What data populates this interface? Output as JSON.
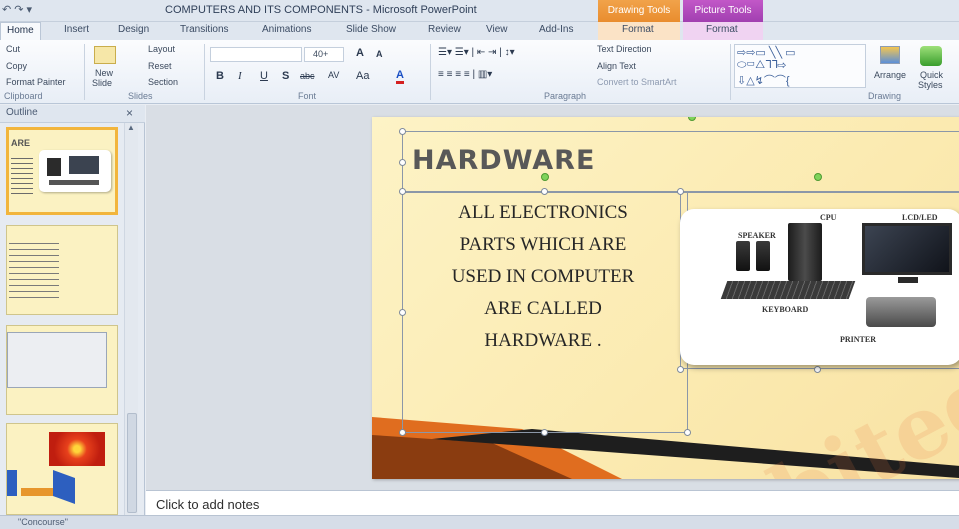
{
  "window": {
    "title": "COMPUTERS AND ITS COMPONENTS  -  Microsoft PowerPoint",
    "context_tabs": {
      "drawing": "Drawing Tools",
      "picture": "Picture Tools"
    }
  },
  "ribbon_tabs": [
    "Home",
    "Insert",
    "Design",
    "Transitions",
    "Animations",
    "Slide Show",
    "Review",
    "View",
    "Add-Ins",
    "Format",
    "Format"
  ],
  "clipboard": {
    "cut": "Cut",
    "copy": "Copy",
    "format_painter": "Format Painter",
    "group": "Clipboard"
  },
  "slides_group": {
    "new_slide_1": "New",
    "new_slide_2": "Slide",
    "layout": "Layout",
    "reset": "Reset",
    "section": "Section",
    "group": "Slides"
  },
  "font": {
    "size": "40+",
    "group": "Font",
    "bold": "B",
    "italic": "I",
    "underline": "U",
    "shadow": "S",
    "strike": "abc",
    "spacing": "AV",
    "case": "Aa",
    "color": "A",
    "grow": "A",
    "shrink": "A"
  },
  "paragraph": {
    "text_direction": "Text Direction",
    "align_text": "Align Text",
    "smartart": "Convert to SmartArt",
    "group": "Paragraph"
  },
  "drawing": {
    "arrange": "Arrange",
    "quick_styles_1": "Quick",
    "quick_styles_2": "Styles",
    "group": "Drawing"
  },
  "pane": {
    "tab": "Outline",
    "close": "×"
  },
  "slide": {
    "title": "HARDWARE",
    "body": [
      "ALL ELECTRONICS",
      "PARTS WHICH ARE",
      "USED IN COMPUTER",
      "ARE CALLED",
      "HARDWARE ."
    ],
    "picture_labels": {
      "cpu": "CPU",
      "monitor": "LCD/LED",
      "speaker": "SPEAKER",
      "keyboard": "KEYBOARD",
      "printer": "PRINTER"
    }
  },
  "thumbnails": {
    "t1_title": "ARE"
  },
  "notes": {
    "placeholder": "Click to add notes"
  },
  "status": {
    "theme": "\"Concourse\""
  },
  "colors": {
    "slide_bg": "#fbeab0",
    "accent_orange": "#e98d2e",
    "accent_purple": "#a13fb0"
  }
}
